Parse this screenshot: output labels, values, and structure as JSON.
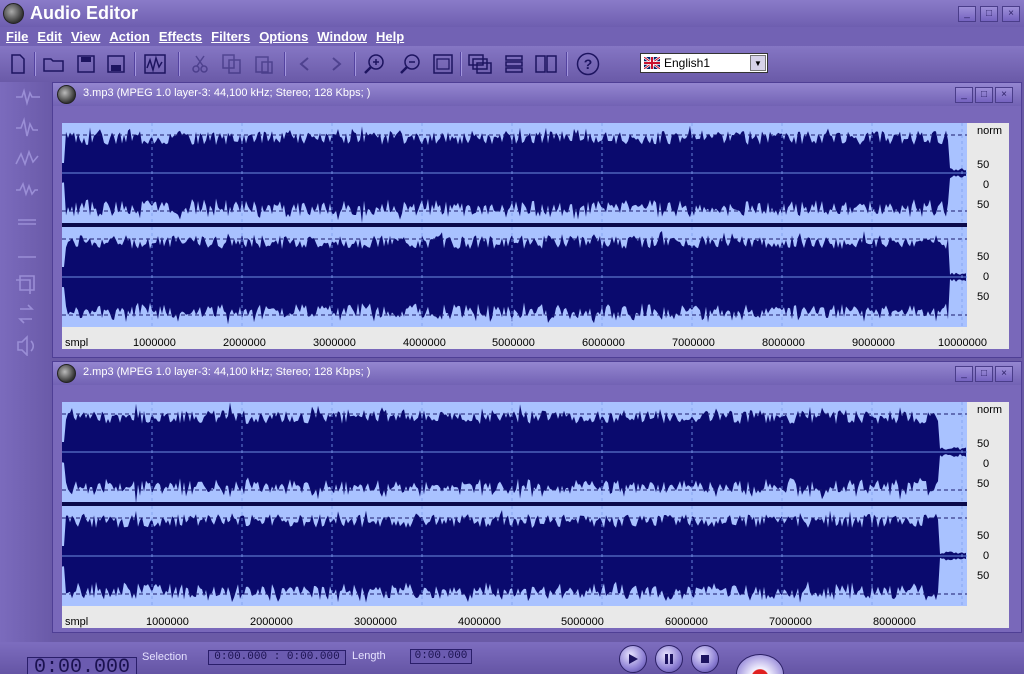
{
  "app": {
    "title": "Audio Editor"
  },
  "menu": [
    "File",
    "Edit",
    "View",
    "Action",
    "Effects",
    "Filters",
    "Options",
    "Window",
    "Help"
  ],
  "toolbar": {
    "icons": [
      "new-file-icon",
      "open-folder-icon",
      "save-icon",
      "save-as-icon",
      "waveform-view-icon",
      "cut-icon",
      "copy-icon",
      "paste-icon",
      "undo-icon",
      "redo-icon",
      "zoom-in-icon",
      "zoom-out-icon",
      "fit-window-icon",
      "cascade-windows-icon",
      "tile-horizontal-icon",
      "tile-vertical-icon",
      "help-icon"
    ],
    "language": "English1"
  },
  "left_tools": [
    "amplify-icon",
    "normalize-icon",
    "fade-in-icon",
    "fade-out-icon",
    "silence-icon",
    "insert-silence-icon",
    "copy-channel-icon",
    "reverse-icon",
    "volume-icon"
  ],
  "docs": [
    {
      "title": "3.mp3 (MPEG 1.0 layer-3: 44,100 kHz; Stereo; 128 Kbps; )",
      "scale_norm": "norm",
      "scale_ticks": [
        "50",
        "0",
        "50",
        "50",
        "0",
        "50"
      ],
      "ruler_unit": "smpl",
      "ruler_ticks": [
        "1000000",
        "2000000",
        "3000000",
        "4000000",
        "5000000",
        "6000000",
        "7000000",
        "8000000",
        "9000000",
        "10000000"
      ]
    },
    {
      "title": "2.mp3 (MPEG 1.0 layer-3: 44,100 kHz; Stereo; 128 Kbps; )",
      "scale_norm": "norm",
      "scale_ticks": [
        "50",
        "0",
        "50",
        "50",
        "0",
        "50"
      ],
      "ruler_unit": "smpl",
      "ruler_ticks": [
        "1000000",
        "2000000",
        "3000000",
        "4000000",
        "5000000",
        "6000000",
        "7000000",
        "8000000"
      ]
    }
  ],
  "status": {
    "time": "0:00.000",
    "selection_label": "Selection",
    "selection_value": "0:00.000 : 0:00.000",
    "length_label": "Length",
    "length_value": "0:00.000"
  },
  "colors": {
    "wave_fill": "#0a0a6e",
    "wave_bg": "#a9c2ff",
    "ui_purple": "#6a5aa6"
  }
}
